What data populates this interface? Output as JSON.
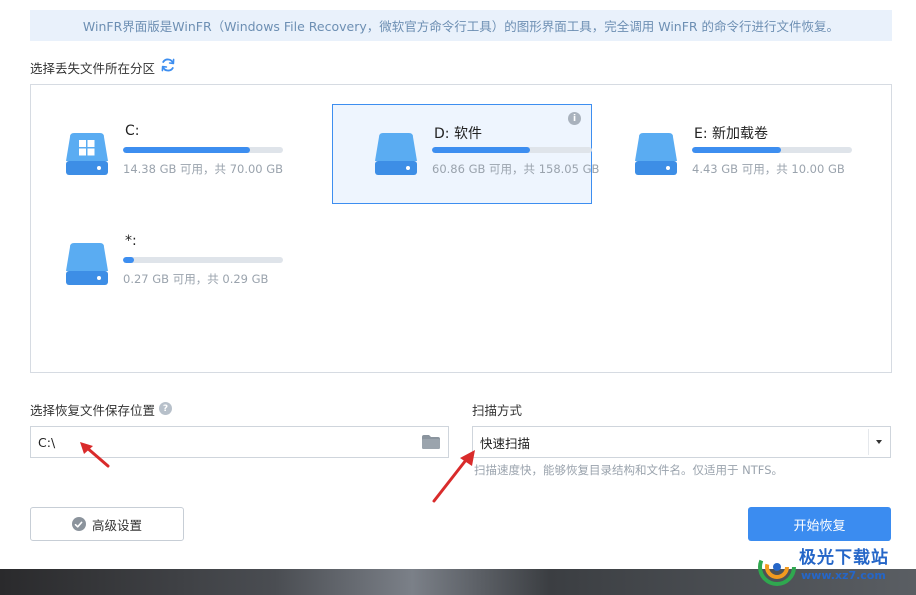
{
  "banner": {
    "text": "WinFR界面版是WinFR（Windows File Recovery，微软官方命令行工具）的图形界面工具，完全调用 WinFR 的命令行进行文件恢复。"
  },
  "partition": {
    "label": "选择丢失文件所在分区",
    "drives": [
      {
        "name": "C:",
        "info": "14.38 GB 可用，共 70.00 GB",
        "used_fraction": 0.795,
        "icon": "windows-drive-icon",
        "selected": false
      },
      {
        "name": "D: 软件",
        "info": "60.86 GB 可用，共 158.05 GB",
        "used_fraction": 0.615,
        "icon": "drive-icon",
        "selected": true
      },
      {
        "name": "E: 新加载卷",
        "info": "4.43 GB 可用，共 10.00 GB",
        "used_fraction": 0.557,
        "icon": "drive-icon",
        "selected": false
      },
      {
        "name": "*:",
        "info": "0.27 GB 可用，共 0.29 GB",
        "used_fraction": 0.069,
        "icon": "drive-icon",
        "selected": false
      }
    ]
  },
  "save": {
    "label": "选择恢复文件保存位置",
    "path_value": "C:\\"
  },
  "scan": {
    "label": "扫描方式",
    "selected": "快速扫描",
    "description": "扫描速度快，能够恢复目录结构和文件名。仅适用于 NTFS。"
  },
  "buttons": {
    "advanced": "高级设置",
    "start": "开始恢复"
  },
  "watermark": {
    "title": "极光下载站",
    "url": "www.xz7.com"
  },
  "colors": {
    "accent": "#3b8cf0",
    "drive_icon": "#4fa3ee",
    "annotation_arrow": "#d92b2b"
  }
}
